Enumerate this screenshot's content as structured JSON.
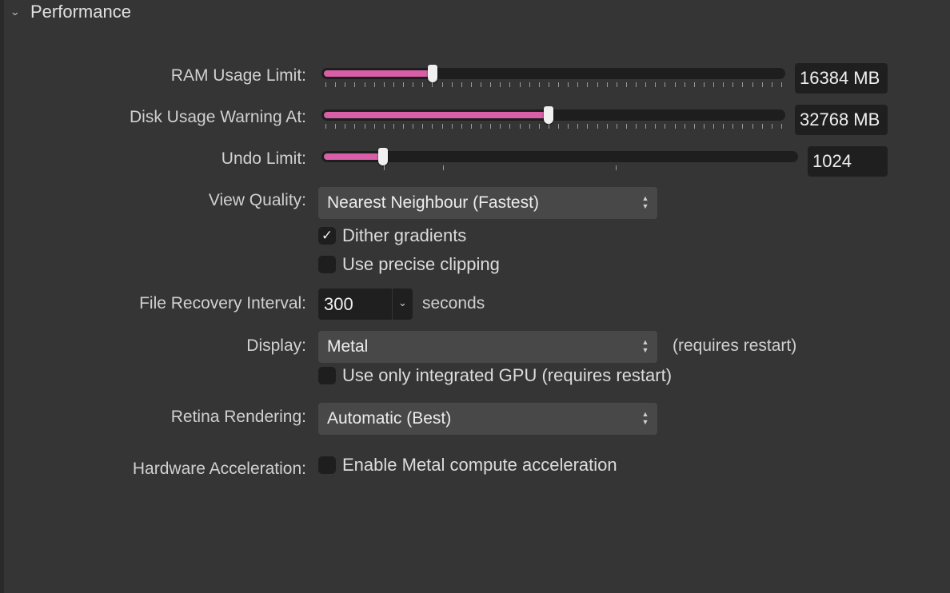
{
  "section": {
    "title": "Performance",
    "collapse_icon": "chevron-down-icon"
  },
  "ram": {
    "label": "RAM Usage Limit:",
    "value": "16384 MB",
    "slider_fraction": 0.24
  },
  "disk": {
    "label": "Disk Usage Warning At:",
    "value": "32768 MB",
    "slider_fraction": 0.49
  },
  "undo": {
    "label": "Undo Limit:",
    "value": "1024",
    "slider_fraction": 0.13
  },
  "view_quality": {
    "label": "View Quality:",
    "selected": "Nearest Neighbour (Fastest)"
  },
  "dither": {
    "label": "Dither gradients",
    "checked": true
  },
  "precise_clipping": {
    "label": "Use precise clipping",
    "checked": false
  },
  "file_recovery": {
    "label": "File Recovery Interval:",
    "value": "300",
    "unit": "seconds"
  },
  "display": {
    "label": "Display:",
    "selected": "Metal",
    "note": "(requires restart)"
  },
  "integrated_gpu": {
    "label": "Use only integrated GPU (requires restart)",
    "checked": false
  },
  "retina": {
    "label": "Retina Rendering:",
    "selected": "Automatic (Best)"
  },
  "hw_accel": {
    "label": "Hardware Acceleration:",
    "checkbox_label": "Enable Metal compute acceleration",
    "checked": false
  },
  "colors": {
    "accent": "#d85fa7",
    "background": "#353535",
    "field": "#1f1f1f",
    "popup": "#484848"
  }
}
